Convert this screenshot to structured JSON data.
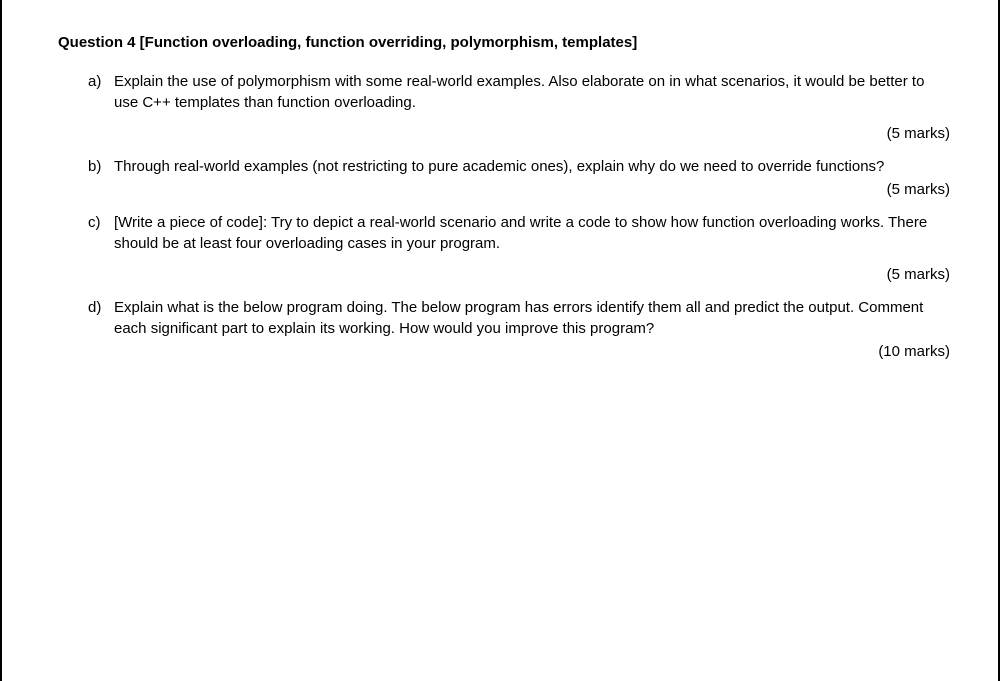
{
  "title": "Question 4 [Function overloading, function overriding, polymorphism, templates]",
  "parts": {
    "a": {
      "label": "a)",
      "text": "Explain the use of polymorphism with some real-world examples. Also elaborate on in what scenarios, it would be better to use C++ templates than function overloading.",
      "marks": "(5 marks)"
    },
    "b": {
      "label": "b)",
      "text": "Through real-world examples (not restricting to pure academic ones), explain why do we need to override functions?",
      "marks": "(5 marks)"
    },
    "c": {
      "label": "c)",
      "text": "[Write a piece of code]: Try to depict a real-world scenario and write a code to show how function overloading works. There should be at least four overloading cases in your program.",
      "marks": "(5 marks)"
    },
    "d": {
      "label": "d)",
      "text": "Explain what is the below program doing. The below program has errors identify them all and predict the output. Comment each significant part to explain its working. How would you improve this program?",
      "marks": "(10 marks)"
    }
  }
}
